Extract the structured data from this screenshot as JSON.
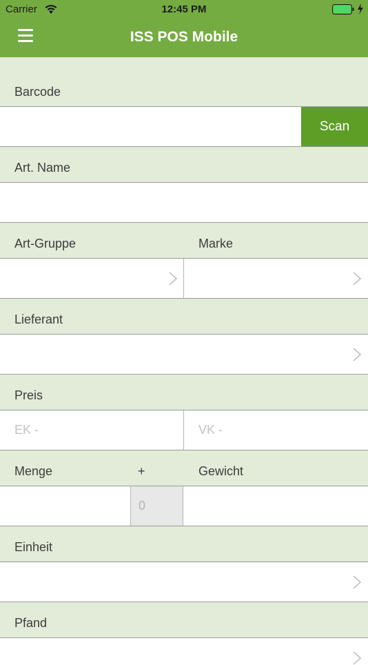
{
  "status": {
    "carrier": "Carrier",
    "time": "12:45 PM"
  },
  "nav": {
    "title": "ISS POS Mobile"
  },
  "form": {
    "barcode_label": "Barcode",
    "scan_label": "Scan",
    "name_label": "Art. Name",
    "group_label": "Art-Gruppe",
    "brand_label": "Marke",
    "supplier_label": "Lieferant",
    "price_label": "Preis",
    "ek_placeholder": "EK -",
    "vk_placeholder": "VK -",
    "qty_label": "Menge",
    "qty_plus": "+",
    "weight_label": "Gewicht",
    "qty_value": "0",
    "unit_label": "Einheit",
    "deposit_label": "Pfand"
  }
}
